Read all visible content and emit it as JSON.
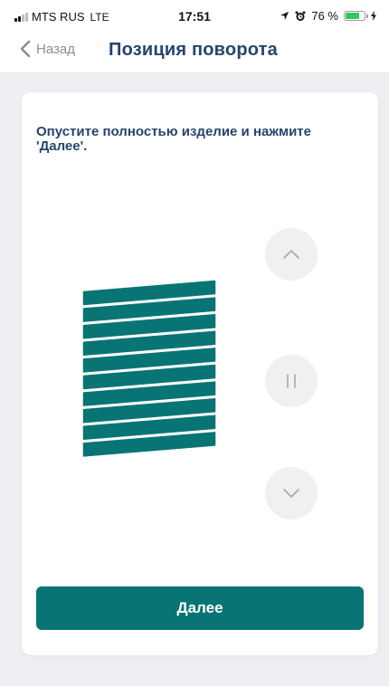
{
  "status_bar": {
    "carrier": "MTS RUS",
    "network": "LTE",
    "time": "17:51",
    "battery_percent": "76 %",
    "battery_level": 0.76,
    "battery_color": "#34c759",
    "icons": [
      "signal-icon",
      "location-icon",
      "alarm-icon",
      "battery-icon",
      "charging-icon"
    ]
  },
  "nav": {
    "back_label": "Назад",
    "title": "Позиция поворота"
  },
  "card": {
    "instruction": "Опустите полностью изделие и нажмите 'Далее'.",
    "blind_slat_count": 10,
    "blind_color": "#087474",
    "controls": {
      "up_icon": "chevron-up-icon",
      "stop_icon": "pause-icon",
      "down_icon": "chevron-down-icon"
    },
    "next_button_label": "Далее"
  },
  "colors": {
    "accent": "#087474",
    "title": "#26456e",
    "background": "#eeeff2"
  }
}
